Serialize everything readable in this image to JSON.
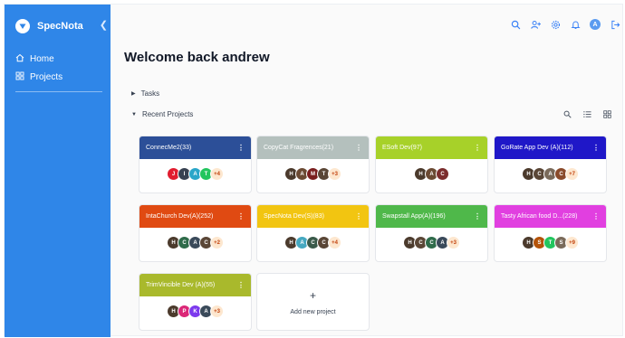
{
  "sidebar": {
    "brand": "SpecNota",
    "collapse_icon": "chevron-left-icon",
    "items": [
      {
        "label": "Home",
        "icon": "home-icon"
      },
      {
        "label": "Projects",
        "icon": "grid-icon"
      }
    ]
  },
  "topbar": {
    "icons": [
      "search-icon",
      "add-user-icon",
      "gear-icon",
      "bell-icon",
      "avatar",
      "logout-icon"
    ],
    "avatar_initial": "A"
  },
  "welcome": "Welcome back andrew",
  "sections": {
    "tasks": "Tasks",
    "recent": "Recent Projects"
  },
  "projects": [
    {
      "title": "ConnecMe2(33)",
      "color": "#2c4f98",
      "avatars": [
        {
          "t": "J",
          "c": "#e11d2f"
        },
        {
          "t": "I",
          "c": "#374151"
        },
        {
          "t": "A",
          "c": "#2aa6c9"
        },
        {
          "t": "T",
          "c": "#22c55e"
        }
      ],
      "more": "+4"
    },
    {
      "title": "CopyCat Fragrences(21)",
      "color": "#b4c0bd",
      "avatars": [
        {
          "t": "H",
          "c": "#4b3a2c"
        },
        {
          "t": "A",
          "c": "#6b4a33"
        },
        {
          "t": "M",
          "c": "#7a1f1f"
        },
        {
          "t": "T",
          "c": "#5a4636"
        }
      ],
      "more": "+3"
    },
    {
      "title": "ESoft Dev(97)",
      "color": "#a7d129",
      "avatars": [
        {
          "t": "H",
          "c": "#4b3a2c"
        },
        {
          "t": "A",
          "c": "#6b4a33"
        },
        {
          "t": "C",
          "c": "#7b2d2d"
        }
      ],
      "more": ""
    },
    {
      "title": "GoRate App Dev (A)(112)",
      "color": "#1f17c8",
      "avatars": [
        {
          "t": "H",
          "c": "#4b3a2c"
        },
        {
          "t": "C",
          "c": "#5a4636"
        },
        {
          "t": "A",
          "c": "#7a6a5a"
        },
        {
          "t": "C",
          "c": "#8a4a2a"
        }
      ],
      "more": "+7"
    },
    {
      "title": "IntaChurch Dev(A)(252)",
      "color": "#e04a12",
      "avatars": [
        {
          "t": "H",
          "c": "#4b3a2c"
        },
        {
          "t": "C",
          "c": "#2f6b4a"
        },
        {
          "t": "A",
          "c": "#3a4a5a"
        },
        {
          "t": "C",
          "c": "#5a4636"
        }
      ],
      "more": "+2"
    },
    {
      "title": "SpecNota Dev(S)(83)",
      "color": "#f2c511",
      "avatars": [
        {
          "t": "H",
          "c": "#4b3a2c"
        },
        {
          "t": "A",
          "c": "#45a8c0"
        },
        {
          "t": "C",
          "c": "#3a5a4a"
        },
        {
          "t": "C",
          "c": "#5a4636"
        }
      ],
      "more": "+4"
    },
    {
      "title": "Swapstall App(A)(196)",
      "color": "#4fb84a",
      "avatars": [
        {
          "t": "H",
          "c": "#4b3a2c"
        },
        {
          "t": "C",
          "c": "#5a4636"
        },
        {
          "t": "C",
          "c": "#2f6b4a"
        },
        {
          "t": "A",
          "c": "#3a4a5a"
        }
      ],
      "more": "+3"
    },
    {
      "title": "Tasty African food D...(228)",
      "color": "#e13fe0",
      "avatars": [
        {
          "t": "H",
          "c": "#4b3a2c"
        },
        {
          "t": "S",
          "c": "#b45309"
        },
        {
          "t": "T",
          "c": "#22c55e"
        },
        {
          "t": "S",
          "c": "#7a6a5a"
        }
      ],
      "more": "+9"
    },
    {
      "title": "TrimVincible Dev (A)(55)",
      "color": "#a9b92c",
      "avatars": [
        {
          "t": "H",
          "c": "#4b3a2c"
        },
        {
          "t": "P",
          "c": "#db2777"
        },
        {
          "t": "K",
          "c": "#7c3aed"
        },
        {
          "t": "A",
          "c": "#3a4a5a"
        }
      ],
      "more": "+3"
    }
  ],
  "add_project": "Add new project"
}
